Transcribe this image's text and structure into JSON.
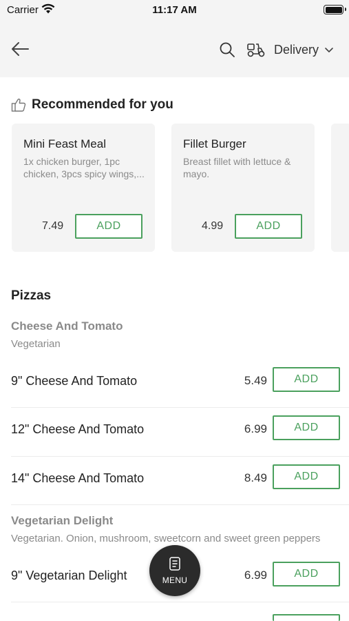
{
  "status_bar": {
    "carrier": "Carrier",
    "time": "11:17 AM"
  },
  "nav": {
    "delivery_label": "Delivery"
  },
  "recommended": {
    "title": "Recommended for you",
    "cards": [
      {
        "name": "Mini Feast Meal",
        "desc": "1x chicken burger, 1pc chicken, 3pcs spicy wings,...",
        "price": "7.49",
        "add_label": "ADD"
      },
      {
        "name": "Fillet  Burger",
        "desc": "Breast fillet with lettuce & mayo.",
        "price": "4.99",
        "add_label": "ADD"
      }
    ]
  },
  "menu": {
    "section_title": "Pizzas",
    "groups": [
      {
        "title": "Cheese And Tomato",
        "subtitle": "Vegetarian",
        "items": [
          {
            "name": "9\" Cheese And Tomato",
            "price": "5.49",
            "add_label": "ADD"
          },
          {
            "name": "12\" Cheese And Tomato",
            "price": "6.99",
            "add_label": "ADD"
          },
          {
            "name": "14\" Cheese And Tomato",
            "price": "8.49",
            "add_label": "ADD"
          }
        ]
      },
      {
        "title": "Vegetarian Delight",
        "subtitle": "Vegetarian. Onion, mushroom, sweetcorn and sweet green peppers",
        "items": [
          {
            "name": "9\" Vegetarian Delight",
            "price": "6.99",
            "add_label": "ADD"
          }
        ]
      }
    ]
  },
  "fab": {
    "label": "MENU"
  },
  "colors": {
    "accent": "#4aa05d",
    "nav_bg": "#f4f4f4",
    "muted_text": "#8a8a8a"
  }
}
